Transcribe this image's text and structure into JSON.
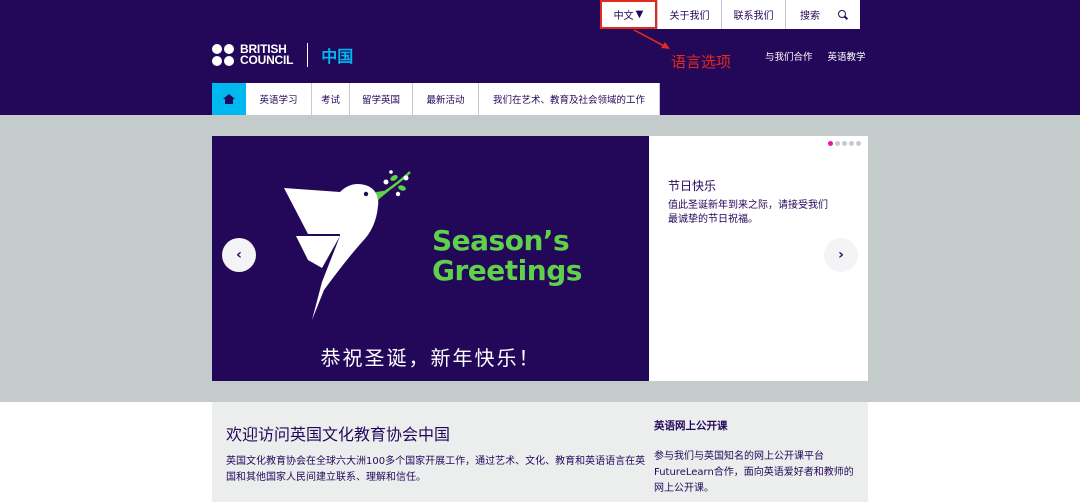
{
  "header": {
    "util": {
      "language": "中文",
      "language_caret": "▼",
      "about": "关于我们",
      "contact": "联系我们",
      "search": "搜索",
      "search_icon": "search-icon"
    },
    "annotation": "语言选项",
    "logo": {
      "line1": "BRITISH",
      "line2": "COUNCIL",
      "country": "中国"
    },
    "secondary_nav": [
      "与我们合作",
      "英语教学"
    ],
    "main_nav": [
      "英语学习",
      "考试",
      "留学英国",
      "最新活动",
      "我们在艺术、教育及社会领域的工作"
    ],
    "home_icon": "home-icon"
  },
  "carousel": {
    "greeting_line1": "Season’s",
    "greeting_line2": "Greetings",
    "greeting_cn": "恭祝圣诞，新年快乐！",
    "slide_title": "节日快乐",
    "slide_desc": "值此圣诞新年到来之际，请接受我们最诚挚的节日祝福。",
    "prev": "‹",
    "next": "›",
    "dots": 5,
    "active_dot": 1
  },
  "content": {
    "welcome_title": "欢迎访问英国文化教育协会中国",
    "welcome_body": "英国文化教育协会在全球六大洲100多个国家开展工作，通过艺术、文化、教育和英语语言在英国和其他国家人民间建立联系、理解和信任。",
    "course_title": "英语网上公开课",
    "course_body": "参与我们与英国知名的网上公开课平台FutureLearn合作，面向英语爱好者和教师的网上公开课。"
  },
  "colors": {
    "brand_purple": "#23085a",
    "accent_blue": "#00b8f0",
    "greeting_green": "#5fd04a",
    "annotation_red": "#e22a1d",
    "dot_active": "#e5189f",
    "hero_grey": "#c4cbcb"
  }
}
